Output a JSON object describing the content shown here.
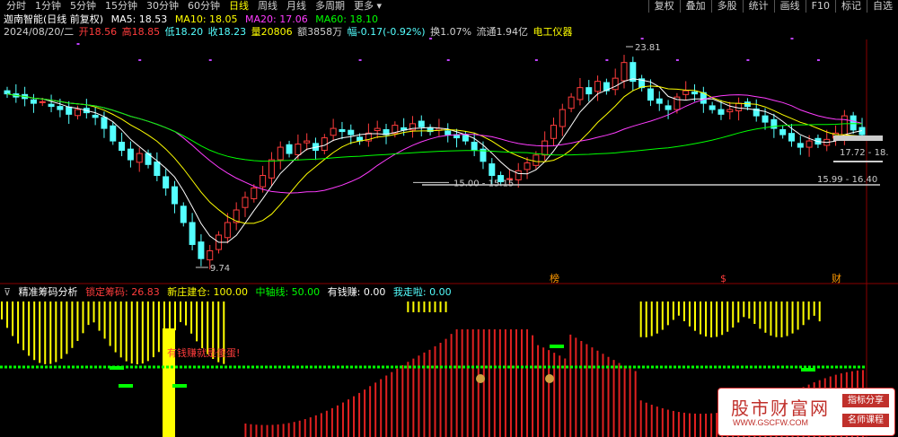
{
  "period_tabs": [
    "分时",
    "1分钟",
    "5分钟",
    "15分钟",
    "30分钟",
    "60分钟",
    "日线",
    "周线",
    "月线",
    "多周期",
    "更多"
  ],
  "active_period": "日线",
  "right_tools": [
    "复权",
    "叠加",
    "多股",
    "统计",
    "画线",
    "F10",
    "标记",
    "自选"
  ],
  "header": {
    "stock_name": "迦南智能(日线 前复权)",
    "ma5": "MA5: 18.53",
    "ma10": "MA10: 18.05",
    "ma20": "MA20: 17.06",
    "ma60": "MA60: 18.10",
    "date": "2024/08/20/二",
    "open": "开18.56",
    "high": "高18.85",
    "low": "低18.20",
    "close": "收18.23",
    "volume": "量20806",
    "amount": "额3858万",
    "change": "幅-0.17(-0.92%)",
    "turnover": "换1.07%",
    "float": "流通1.94亿",
    "sector": "电工仪器"
  },
  "colors": {
    "up": "#ff3c3c",
    "down": "#54ffff",
    "ma5": "#ffffff",
    "ma10": "#ffff00",
    "ma20": "#ff3cff",
    "ma60": "#00ff00",
    "chip_yellow": "#ffff00",
    "chip_red": "#e02020",
    "chip_green": "#00ff00"
  },
  "annotations": {
    "high_label": "23.81",
    "low_label": "9.74",
    "zone1": "15.00 - 15.15",
    "zone2": "15.99 - 16.40",
    "zone3": "17.72 - 18.",
    "event1": "榜",
    "event2": "$",
    "event3": "财"
  },
  "chart_data": [
    {
      "type": "candlestick",
      "title": "迦南智能(日线 前复权)",
      "series": [
        {
          "name": "MA5",
          "value": 18.53
        },
        {
          "name": "MA10",
          "value": 18.05
        },
        {
          "name": "MA20",
          "value": 17.06
        },
        {
          "name": "MA60",
          "value": 18.1
        }
      ],
      "close": [
        20.8,
        20.6,
        20.5,
        20.2,
        20.3,
        20.0,
        19.8,
        19.5,
        19.8,
        19.6,
        19.3,
        18.6,
        17.8,
        17.2,
        16.6,
        17.0,
        16.3,
        15.6,
        14.8,
        13.8,
        12.6,
        11.2,
        10.3,
        10.8,
        11.8,
        12.6,
        13.4,
        14.2,
        14.8,
        15.6,
        16.6,
        17.4,
        17.0,
        17.6,
        17.8,
        17.2,
        18.0,
        18.6,
        18.4,
        18.2,
        17.8,
        18.3,
        18.6,
        18.2,
        18.8,
        18.5,
        18.9,
        18.7,
        18.4,
        18.6,
        18.2,
        18.0,
        17.8,
        17.2,
        16.5,
        15.6,
        15.2,
        15.4,
        15.9,
        16.4,
        16.9,
        17.8,
        18.8,
        19.8,
        20.6,
        21.2,
        20.8,
        21.6,
        21.0,
        21.8,
        22.8,
        21.6,
        21.2,
        20.4,
        20.2,
        19.8,
        20.6,
        21.0,
        20.8,
        20.2,
        19.8,
        19.5,
        19.8,
        20.2,
        20.0,
        19.4,
        19.0,
        18.6,
        18.2,
        17.8,
        17.4,
        17.8,
        17.6,
        17.9,
        18.3,
        19.4,
        18.5,
        18.2
      ],
      "ylim": [
        9.74,
        23.81
      ],
      "zones": [
        "15.00 - 15.15",
        "15.99 - 16.40",
        "17.72 - 18."
      ]
    },
    {
      "type": "bar",
      "title": "精准筹码分析",
      "values": {
        "锁定筹码": 26.83,
        "新庄建仓": 100.0,
        "中轴线": 50.0,
        "有钱赚": 0.0,
        "我走啦": 0.0
      },
      "annotation": "有钱赚就是傻蛋!"
    }
  ],
  "sub": {
    "title": "精准筹码分析",
    "lock": "锁定筹码: 26.83",
    "new": "新庄建仓: 100.00",
    "axis": "中轴线: 50.00",
    "profit": "有钱赚: 0.00",
    "leave": "我走啦: 0.00",
    "note": "有钱赚就是傻蛋!"
  },
  "watermark": {
    "title": "股市财富网",
    "url": "WWW.GSCFW.COM",
    "tag1": "指标分享",
    "tag2": "名师课程"
  }
}
